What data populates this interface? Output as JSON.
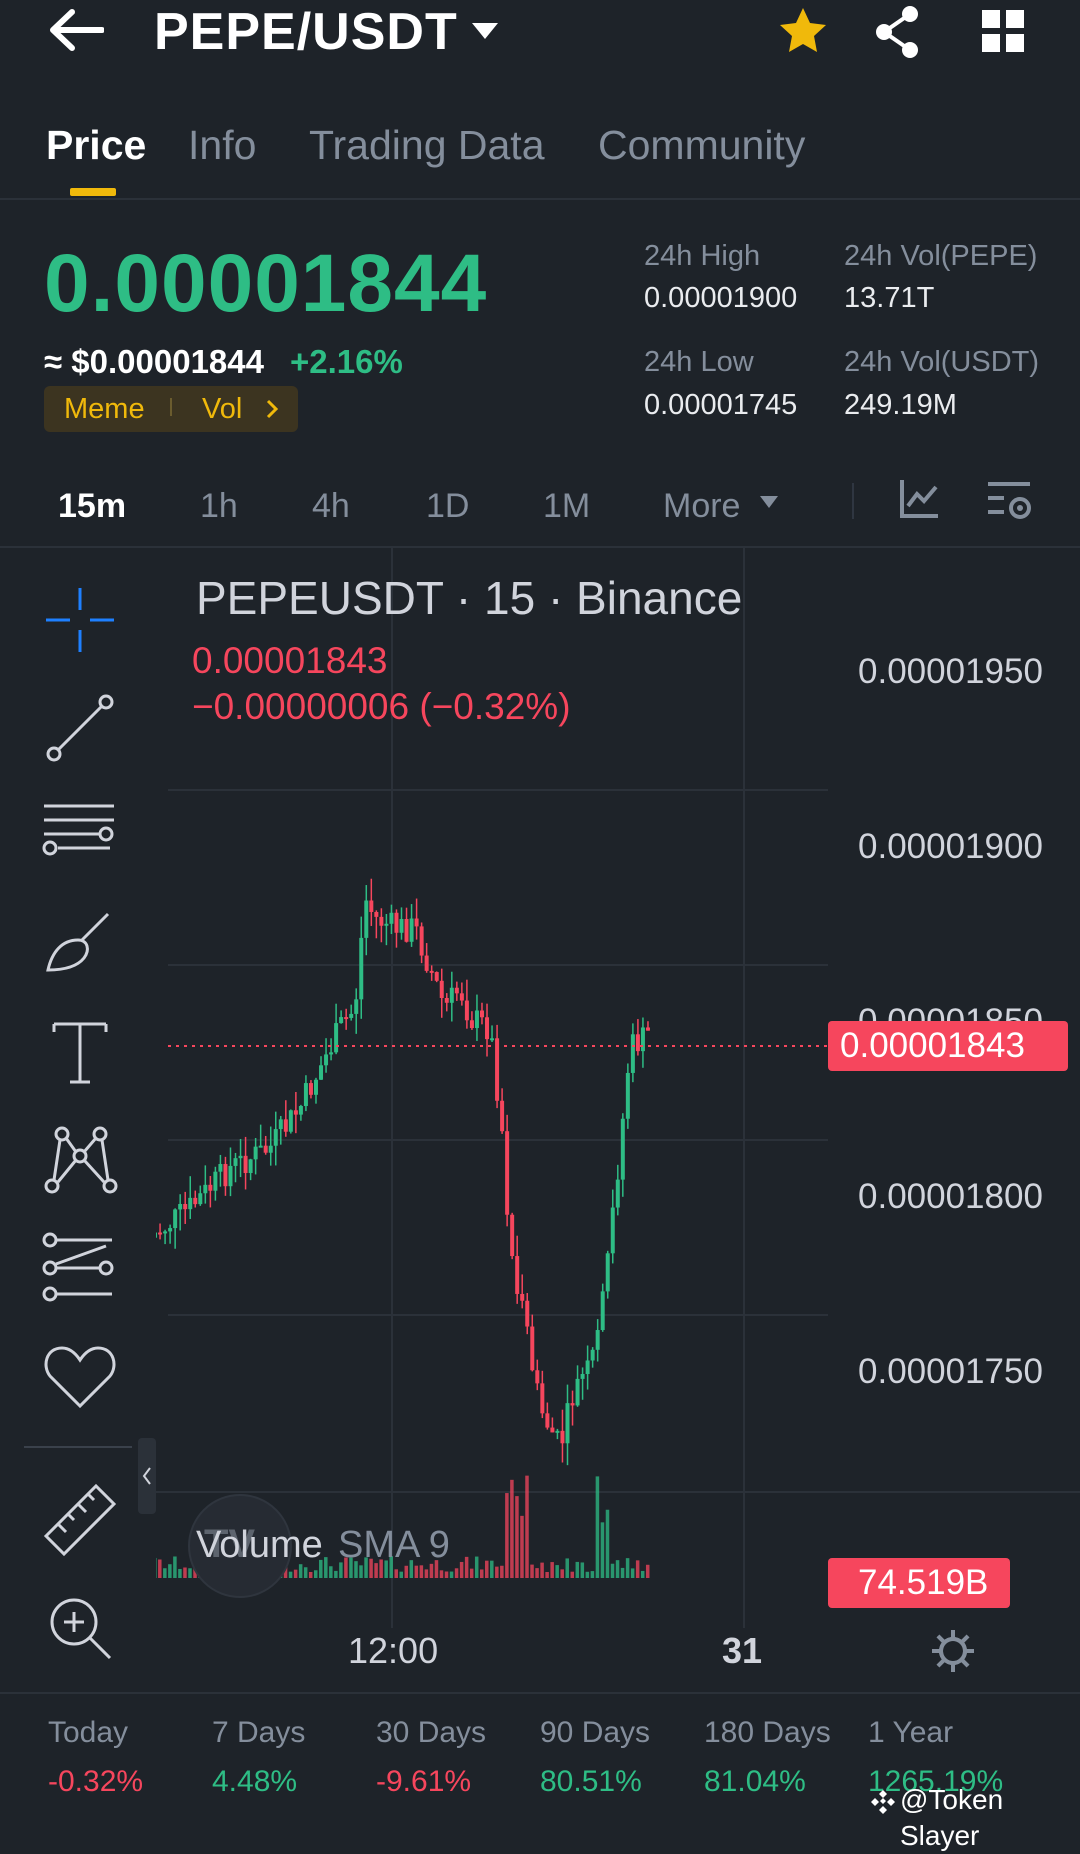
{
  "header": {
    "pair": "PEPE/USDT",
    "icons": [
      "back-arrow-icon",
      "chevron-down-icon",
      "star-icon",
      "share-icon",
      "grid-icon"
    ],
    "star_color": "#f0b90b"
  },
  "tabs": [
    {
      "label": "Price",
      "active": true
    },
    {
      "label": "Info"
    },
    {
      "label": "Trading Data"
    },
    {
      "label": "Community"
    }
  ],
  "price": {
    "last": "0.00001844",
    "usd": "≈ $0.00001844",
    "change": "+2.16%",
    "tags": [
      "Meme",
      "Vol"
    ],
    "stats": {
      "high_label": "24h High",
      "high": "0.00001900",
      "low_label": "24h Low",
      "low": "0.00001745",
      "vol_base_label": "24h Vol(PEPE)",
      "vol_base": "13.71T",
      "vol_quote_label": "24h Vol(USDT)",
      "vol_quote": "249.19M"
    }
  },
  "intervals": [
    "15m",
    "1h",
    "4h",
    "1D",
    "1M",
    "More"
  ],
  "active_interval": "15m",
  "chart": {
    "title": "PEPEUSDT · 15 · Binance",
    "ohlc_close": "0.00001843",
    "change": "−0.00000006 (−0.32%)",
    "price_ticks": [
      "0.00001950",
      "0.00001900",
      "0.00001850",
      "0.00001800",
      "0.00001750"
    ],
    "current_price_label": "0.00001843",
    "volume_indicator": "Volume",
    "volume_sma": "SMA 9",
    "volume_value": "74.519B",
    "time_ticks": [
      "12:00",
      "31"
    ],
    "watermark_logo": "TV",
    "up_color": "#2ebd85",
    "down_color": "#f6465d"
  },
  "toolbar": [
    "crosshair-icon",
    "trendline-icon",
    "fib-lines-icon",
    "brush-icon",
    "text-icon",
    "pattern-icon",
    "forecast-icon",
    "favorite-icon",
    "ruler-icon",
    "zoom-in-icon"
  ],
  "performance": [
    {
      "label": "Today",
      "value": "-0.32%",
      "dir": "neg"
    },
    {
      "label": "7 Days",
      "value": "4.48%",
      "dir": "pos"
    },
    {
      "label": "30 Days",
      "value": "-9.61%",
      "dir": "neg"
    },
    {
      "label": "90 Days",
      "value": "80.51%",
      "dir": "pos"
    },
    {
      "label": "180 Days",
      "value": "81.04%",
      "dir": "pos"
    },
    {
      "label": "1 Year",
      "value": "1265.19%",
      "dir": "pos"
    }
  ],
  "watermark": "@Token Slayer"
}
